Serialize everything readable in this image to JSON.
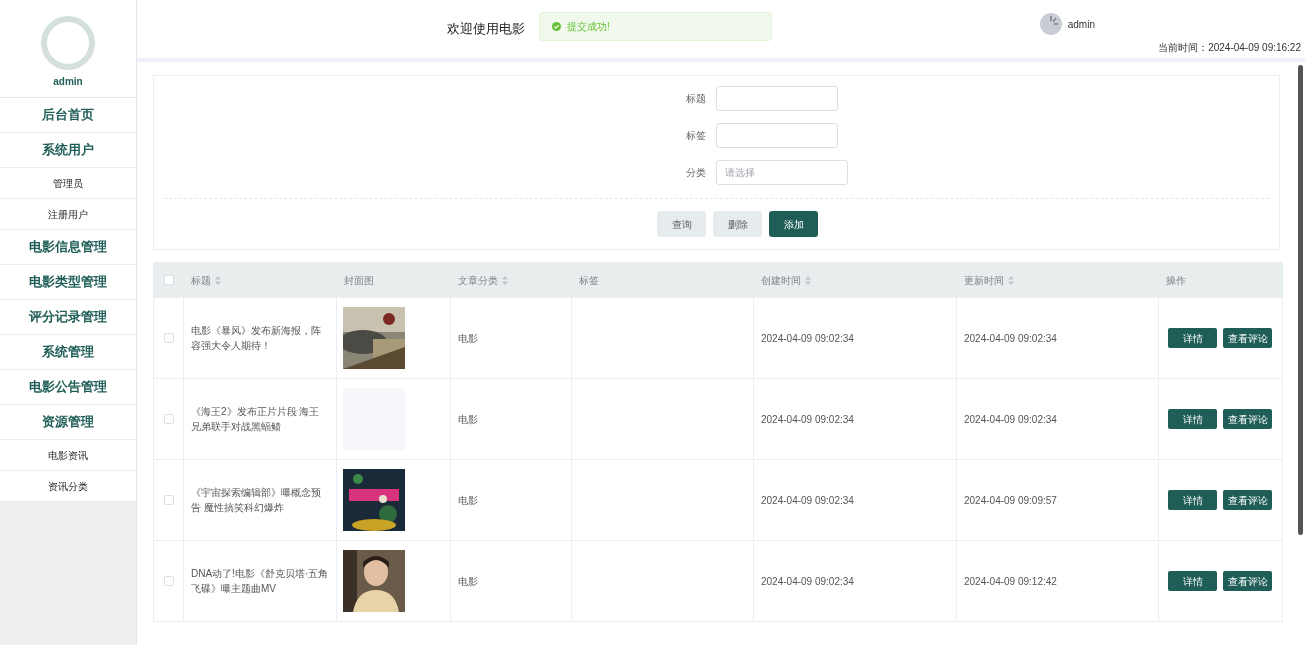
{
  "sidebar": {
    "user": "admin",
    "menu": [
      {
        "label": "后台首页"
      },
      {
        "label": "系统用户",
        "children": [
          {
            "label": "管理员"
          },
          {
            "label": "注册用户"
          }
        ]
      },
      {
        "label": "电影信息管理"
      },
      {
        "label": "电影类型管理"
      },
      {
        "label": "评分记录管理"
      },
      {
        "label": "系统管理"
      },
      {
        "label": "电影公告管理"
      },
      {
        "label": "资源管理",
        "children": [
          {
            "label": "电影资讯"
          },
          {
            "label": "资讯分类"
          }
        ]
      }
    ]
  },
  "header": {
    "title": "欢迎使用电影",
    "user": "admin",
    "time_label": "当前时间：",
    "time": "2024-04-09 09:16:22"
  },
  "toast": {
    "text": "提交成功!"
  },
  "search_form": {
    "fields": [
      {
        "label": "标题",
        "kind": "input"
      },
      {
        "label": "标签",
        "kind": "input"
      },
      {
        "label": "分类",
        "kind": "select",
        "placeholder": "请选择"
      }
    ],
    "buttons": [
      {
        "label": "查询",
        "primary": false
      },
      {
        "label": "删除",
        "primary": false
      },
      {
        "label": "添加",
        "primary": true
      }
    ]
  },
  "table": {
    "header_checked": false,
    "columns": [
      {
        "label": "标题",
        "sortable": true
      },
      {
        "label": "封面图",
        "sortable": false
      },
      {
        "label": "文章分类",
        "sortable": true
      },
      {
        "label": "标签",
        "sortable": false
      },
      {
        "label": "创建时间",
        "sortable": true
      },
      {
        "label": "更新时间",
        "sortable": true
      },
      {
        "label": "操作",
        "sortable": false
      }
    ],
    "rows": [
      {
        "checked": false,
        "title": "电影《暴风》发布新海报，阵容强大令人期待！",
        "cover": {
          "kind": "picture"
        },
        "category": "电影",
        "created": "2024-04-09 09:02:34",
        "updated": "2024-04-09 09:02:34",
        "actions": [
          "详情",
          "查看评论"
        ]
      },
      {
        "checked": false,
        "title": "《海王2》发布正片片段 海王兄弟联手对战黑蝠鲼",
        "cover": {
          "kind": "empty"
        },
        "category": "电影",
        "created": "2024-04-09 09:02:34",
        "updated": "2024-04-09 09:02:34",
        "actions": [
          "详情",
          "查看评论"
        ]
      },
      {
        "checked": false,
        "title": "《宇宙探索编辑部》曝概念预告 魔性搞笑科幻爆炸",
        "cover": {
          "kind": "picture"
        },
        "category": "电影",
        "created": "2024-04-09 09:02:34",
        "updated": "2024-04-09 09:09:57",
        "actions": [
          "详情",
          "查看评论"
        ]
      },
      {
        "checked": false,
        "title": "DNA动了!电影《舒克贝塔·五角飞碟》曝主题曲MV",
        "cover": {
          "kind": "picture"
        },
        "category": "电影",
        "created": "2024-04-09 09:02:34",
        "updated": "2024-04-09 09:12:42",
        "actions": [
          "详情",
          "查看评论"
        ]
      }
    ]
  }
}
